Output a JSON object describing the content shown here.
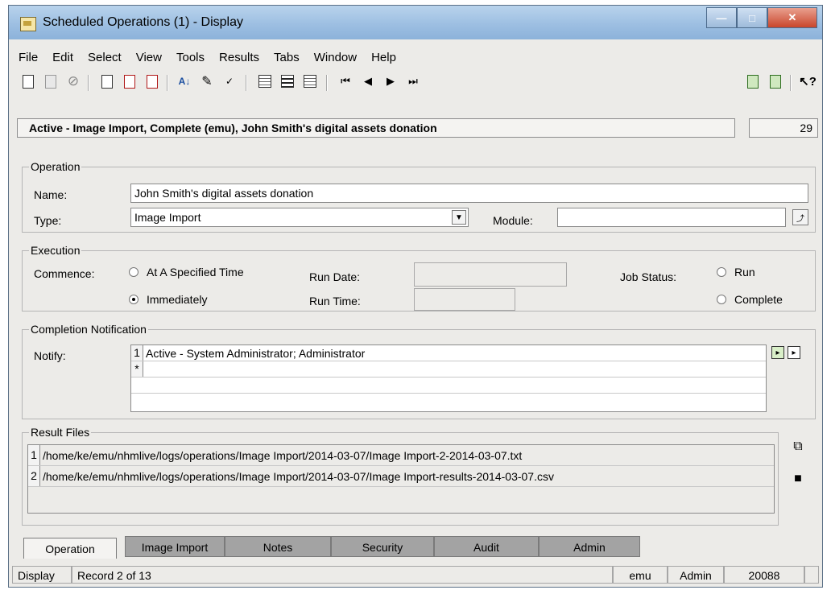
{
  "window": {
    "title": "Scheduled Operations (1) - Display"
  },
  "menu": [
    "File",
    "Edit",
    "Select",
    "View",
    "Tools",
    "Results",
    "Tabs",
    "Window",
    "Help"
  ],
  "record_bar": {
    "title": "Active - Image Import, Complete  (emu), John Smith's digital assets donation",
    "count": "29"
  },
  "operation": {
    "legend": "Operation",
    "name_label": "Name:",
    "name_value": "John Smith's digital assets donation",
    "type_label": "Type:",
    "type_value": "Image Import",
    "module_label": "Module:",
    "module_value": ""
  },
  "execution": {
    "legend": "Execution",
    "commence_label": "Commence:",
    "opt_specified": "At A Specified Time",
    "opt_immediately": "Immediately",
    "selected": "Immediately",
    "run_date_label": "Run Date:",
    "run_date_value": "",
    "run_time_label": "Run Time:",
    "run_time_value": "",
    "job_status_label": "Job Status:",
    "opt_run": "Run",
    "opt_complete": "Complete"
  },
  "completion": {
    "legend": "Completion Notification",
    "notify_label": "Notify:",
    "rows": [
      {
        "num": "1",
        "text": "Active - System Administrator; Administrator"
      },
      {
        "num": "*",
        "text": ""
      }
    ]
  },
  "results": {
    "legend": "Result Files",
    "rows": [
      {
        "num": "1",
        "text": "/home/ke/emu/nhmlive/logs/operations/Image Import/2014-03-07/Image Import-2-2014-03-07.txt"
      },
      {
        "num": "2",
        "text": "/home/ke/emu/nhmlive/logs/operations/Image Import/2014-03-07/Image Import-results-2014-03-07.csv"
      }
    ]
  },
  "tabs": [
    "Operation",
    "Image Import",
    "Notes",
    "Security",
    "Audit",
    "Admin"
  ],
  "active_tab": "Operation",
  "status": {
    "mode": "Display",
    "record": "Record 2 of 13",
    "user": "emu",
    "group": "Admin",
    "port": "20088"
  }
}
